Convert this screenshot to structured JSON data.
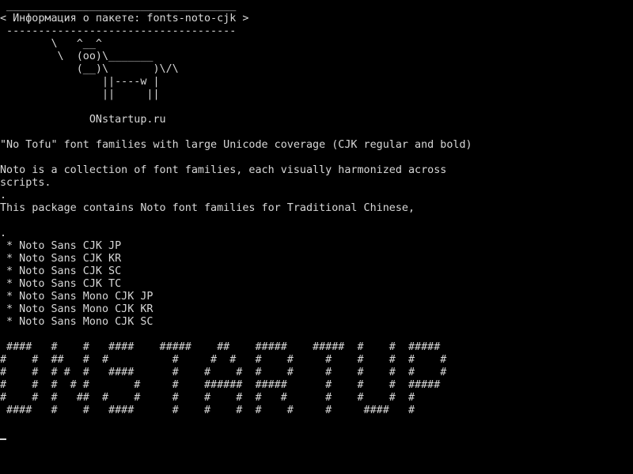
{
  "terminal": {
    "lines": [
      " ____________________________________",
      "< Информация о пакете: fonts-noto-cjk >",
      " ------------------------------------",
      "        \\   ^__^",
      "         \\  (oo)\\_______",
      "            (__)\\       )\\/\\",
      "                ||----w |",
      "                ||     ||",
      "",
      "              ONstartup.ru",
      "",
      "\"No Tofu\" font families with large Unicode coverage (CJK regular and bold)",
      "",
      "Noto is a collection of font families, each visually harmonized across",
      "scripts.",
      ".",
      "This package contains Noto font families for Traditional Chinese,",
      "",
      ".",
      " * Noto Sans CJK JP",
      " * Noto Sans CJK KR",
      " * Noto Sans CJK SC",
      " * Noto Sans CJK TC",
      " * Noto Sans Mono CJK JP",
      " * Noto Sans Mono CJK KR",
      " * Noto Sans Mono CJK SC",
      "",
      " ####   #    #   ####    #####    ##    #####    #####  #    #  #####",
      "#    #  ##   #  #          #     #  #   #    #     #    #    #  #    #",
      "#    #  # #  #   ####      #    #    #  #    #     #    #    #  #    #",
      "#    #  #  # #       #     #    ######  #####      #    #    #  #####",
      "#    #  #   ##  #    #     #    #    #  #   #      #    #    #  #",
      " ####   #    #   ####      #    #    #  #    #     #     ####   #"
    ]
  }
}
